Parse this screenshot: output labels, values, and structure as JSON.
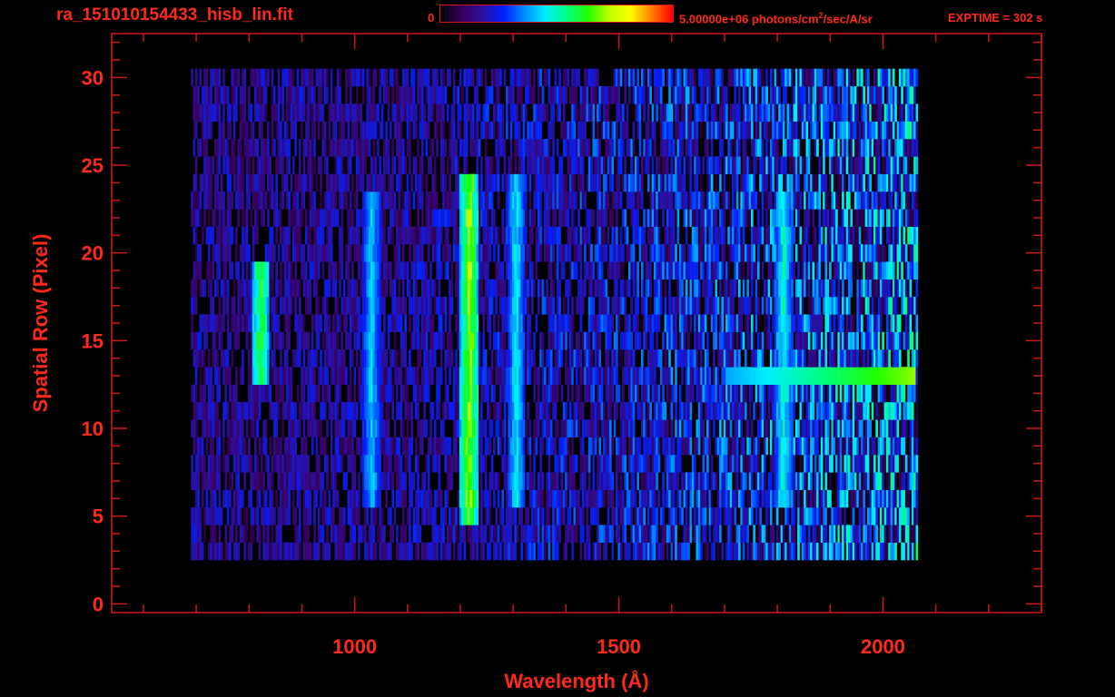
{
  "header": {
    "file_title": "ra_151010154433_hisb_lin.fit",
    "colorbar_min": "0",
    "colorbar_max_value": "5.00000e+06 photons/cm",
    "colorbar_max_exp": "2",
    "colorbar_max_unit": "/sec/A/sr",
    "exptime": "EXPTIME = 302 s"
  },
  "colors": {
    "axis": "#d01818",
    "text": "#ff2a1a",
    "background": "#000000",
    "colormap": [
      "#000000",
      "#3a0060",
      "#2a10a0",
      "#0020ff",
      "#0090ff",
      "#00f0ff",
      "#00ff80",
      "#20ff00",
      "#c0ff00",
      "#ffff00",
      "#ff8000",
      "#ff0000"
    ]
  },
  "chart_data": {
    "type": "heatmap",
    "title": "ra_151010154433_hisb_lin.fit",
    "xlabel": "Wavelength (Å)",
    "ylabel": "Spatial Row (Pixel)",
    "xlim": [
      540,
      2300
    ],
    "ylim": [
      -0.5,
      32.5
    ],
    "x_ticks": [
      1000,
      1500,
      2000
    ],
    "y_ticks": [
      0,
      5,
      10,
      15,
      20,
      25,
      30
    ],
    "x_minor_step": 100,
    "y_minor_step": 1,
    "value_range": [
      0,
      5000000
    ],
    "value_unit": "photons/cm^2/sec/A/sr",
    "exposure_time_s": 302,
    "data_region_x": [
      690,
      2065
    ],
    "data_region_y": [
      3,
      30
    ],
    "emission_features": [
      {
        "wavelength": 820,
        "rows": [
          13,
          19
        ],
        "intensity": 0.62
      },
      {
        "wavelength": 1030,
        "rows": [
          6,
          23
        ],
        "intensity": 0.42
      },
      {
        "wavelength": 1215,
        "rows": [
          5,
          24
        ],
        "intensity": 0.72
      },
      {
        "wavelength": 1304,
        "rows": [
          6,
          24
        ],
        "intensity": 0.45
      },
      {
        "wavelength": 1810,
        "rows": [
          6,
          23
        ],
        "intensity": 0.48
      }
    ],
    "bright_row_features": [
      {
        "row": 13,
        "wavelength": [
          1700,
          2060
        ],
        "intensity": 0.7
      }
    ]
  }
}
